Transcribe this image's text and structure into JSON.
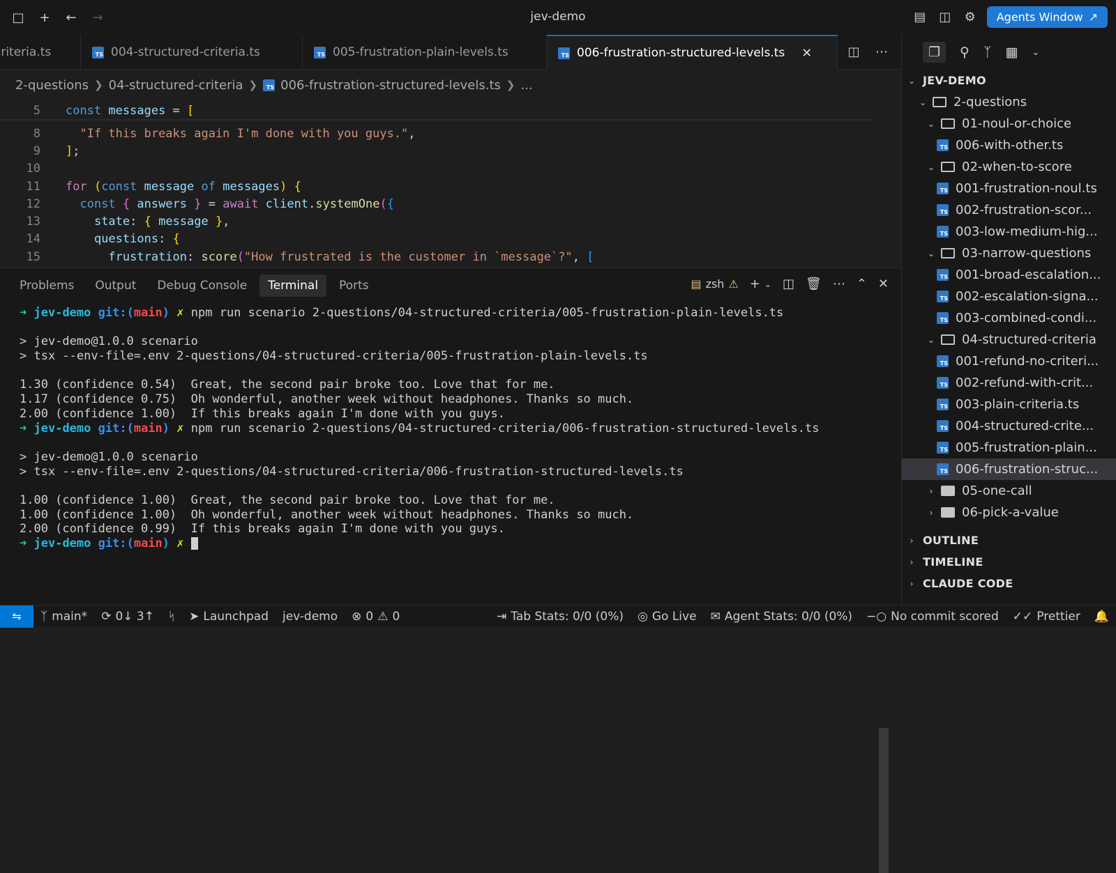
{
  "window": {
    "title": "jev-demo",
    "agents_button": "Agents Window"
  },
  "tabs": [
    {
      "label": "criteria.ts"
    },
    {
      "label": "004-structured-criteria.ts"
    },
    {
      "label": "005-frustration-plain-levels.ts"
    },
    {
      "label": "006-frustration-structured-levels.ts",
      "active": true
    }
  ],
  "breadcrumb": [
    "2-questions",
    "04-structured-criteria",
    "006-frustration-structured-levels.ts",
    "..."
  ],
  "editor": {
    "lines": [
      {
        "n": "5",
        "tokens": [
          [
            "kw",
            "const "
          ],
          [
            "var",
            "messages"
          ],
          [
            "pun",
            " = "
          ],
          [
            "br1",
            "["
          ]
        ]
      },
      {
        "n": "8",
        "tokens": [
          [
            "pun",
            "  "
          ],
          [
            "str",
            "\"If this breaks again I'm done with you guys.\""
          ],
          [
            "pun",
            ","
          ]
        ]
      },
      {
        "n": "9",
        "tokens": [
          [
            "br1",
            "]"
          ],
          [
            "pun",
            ";"
          ]
        ]
      },
      {
        "n": "10",
        "tokens": []
      },
      {
        "n": "11",
        "tokens": [
          [
            "ctl",
            "for "
          ],
          [
            "br1",
            "("
          ],
          [
            "kw",
            "const "
          ],
          [
            "var",
            "message "
          ],
          [
            "kw",
            "of "
          ],
          [
            "var",
            "messages"
          ],
          [
            "br1",
            ")"
          ],
          [
            "pun",
            " "
          ],
          [
            "br1",
            "{"
          ]
        ]
      },
      {
        "n": "12",
        "tokens": [
          [
            "pun",
            "  "
          ],
          [
            "kw",
            "const "
          ],
          [
            "br2",
            "{ "
          ],
          [
            "var",
            "answers "
          ],
          [
            "br2",
            "}"
          ],
          [
            "pun",
            " = "
          ],
          [
            "ctl",
            "await "
          ],
          [
            "var",
            "client"
          ],
          [
            "pun",
            "."
          ],
          [
            "fn",
            "systemOne"
          ],
          [
            "br2",
            "("
          ],
          [
            "br3",
            "{"
          ]
        ]
      },
      {
        "n": "13",
        "tokens": [
          [
            "pun",
            "    "
          ],
          [
            "var",
            "state"
          ],
          [
            "pun",
            ": "
          ],
          [
            "br1",
            "{ "
          ],
          [
            "var",
            "message "
          ],
          [
            "br1",
            "}"
          ],
          [
            "pun",
            ","
          ]
        ]
      },
      {
        "n": "14",
        "tokens": [
          [
            "pun",
            "    "
          ],
          [
            "var",
            "questions"
          ],
          [
            "pun",
            ": "
          ],
          [
            "br1",
            "{"
          ]
        ]
      },
      {
        "n": "15",
        "tokens": [
          [
            "pun",
            "      "
          ],
          [
            "var",
            "frustration"
          ],
          [
            "pun",
            ": "
          ],
          [
            "fn",
            "score"
          ],
          [
            "br2",
            "("
          ],
          [
            "str",
            "\"How frustrated is the customer in `message`?\""
          ],
          [
            "pun",
            ", "
          ],
          [
            "br3",
            "["
          ]
        ]
      }
    ]
  },
  "panel": {
    "tabs": [
      "Problems",
      "Output",
      "Debug Console",
      "Terminal",
      "Ports"
    ],
    "active_tab": "Terminal",
    "shell": "zsh"
  },
  "terminal": {
    "prompt": {
      "arrow": "➜",
      "repo": "jev-demo",
      "git": "git:(",
      "branch": "main",
      "git_close": ")",
      "dirty": "✗"
    },
    "lines": [
      {
        "type": "prompt",
        "cmd": "npm run scenario 2-questions/04-structured-criteria/005-frustration-plain-levels.ts"
      },
      {
        "type": "blank"
      },
      {
        "type": "text",
        "text": "> jev-demo@1.0.0 scenario"
      },
      {
        "type": "text",
        "text": "> tsx --env-file=.env 2-questions/04-structured-criteria/005-frustration-plain-levels.ts"
      },
      {
        "type": "blank"
      },
      {
        "type": "text",
        "text": "1.30 (confidence 0.54)  Great, the second pair broke too. Love that for me."
      },
      {
        "type": "text",
        "text": "1.17 (confidence 0.75)  Oh wonderful, another week without headphones. Thanks so much."
      },
      {
        "type": "text",
        "text": "2.00 (confidence 1.00)  If this breaks again I'm done with you guys."
      },
      {
        "type": "prompt",
        "cmd": "npm run scenario 2-questions/04-structured-criteria/006-frustration-structured-levels.ts"
      },
      {
        "type": "blank"
      },
      {
        "type": "text",
        "text": "> jev-demo@1.0.0 scenario"
      },
      {
        "type": "text",
        "text": "> tsx --env-file=.env 2-questions/04-structured-criteria/006-frustration-structured-levels.ts"
      },
      {
        "type": "blank"
      },
      {
        "type": "text",
        "text": "1.00 (confidence 1.00)  Great, the second pair broke too. Love that for me."
      },
      {
        "type": "text",
        "text": "1.00 (confidence 1.00)  Oh wonderful, another week without headphones. Thanks so much."
      },
      {
        "type": "text",
        "text": "2.00 (confidence 0.99)  If this breaks again I'm done with you guys."
      },
      {
        "type": "prompt_cursor",
        "cmd": ""
      }
    ]
  },
  "explorer": {
    "root": "JEV-DEMO",
    "rows": [
      {
        "kind": "folder",
        "open": true,
        "depth": 1,
        "label": "2-questions"
      },
      {
        "kind": "folder",
        "open": true,
        "depth": 2,
        "label": "01-noul-or-choice"
      },
      {
        "kind": "file",
        "depth": 3,
        "label": "006-with-other.ts"
      },
      {
        "kind": "folder",
        "open": true,
        "depth": 2,
        "label": "02-when-to-score"
      },
      {
        "kind": "file",
        "depth": 3,
        "label": "001-frustration-noul.ts"
      },
      {
        "kind": "file",
        "depth": 3,
        "label": "002-frustration-scor..."
      },
      {
        "kind": "file",
        "depth": 3,
        "label": "003-low-medium-hig..."
      },
      {
        "kind": "folder",
        "open": true,
        "depth": 2,
        "label": "03-narrow-questions"
      },
      {
        "kind": "file",
        "depth": 3,
        "label": "001-broad-escalation..."
      },
      {
        "kind": "file",
        "depth": 3,
        "label": "002-escalation-signa..."
      },
      {
        "kind": "file",
        "depth": 3,
        "label": "003-combined-condi..."
      },
      {
        "kind": "folder",
        "open": true,
        "depth": 2,
        "label": "04-structured-criteria"
      },
      {
        "kind": "file",
        "depth": 3,
        "label": "001-refund-no-criteri..."
      },
      {
        "kind": "file",
        "depth": 3,
        "label": "002-refund-with-crit..."
      },
      {
        "kind": "file",
        "depth": 3,
        "label": "003-plain-criteria.ts"
      },
      {
        "kind": "file",
        "depth": 3,
        "label": "004-structured-crite..."
      },
      {
        "kind": "file",
        "depth": 3,
        "label": "005-frustration-plain..."
      },
      {
        "kind": "file",
        "depth": 3,
        "label": "006-frustration-struc...",
        "selected": true
      },
      {
        "kind": "folder",
        "open": false,
        "depth": 2,
        "label": "05-one-call"
      },
      {
        "kind": "folder",
        "open": false,
        "depth": 2,
        "label": "06-pick-a-value"
      }
    ],
    "sections": [
      "OUTLINE",
      "TIMELINE",
      "CLAUDE CODE"
    ]
  },
  "statusbar": {
    "branch": "main*",
    "sync": "0↓ 3↑",
    "launchpad": "Launchpad",
    "workspace": "jev-demo",
    "errors": "0",
    "warnings": "0",
    "tab_stats": "Tab Stats: 0/0 (0%)",
    "go_live": "Go Live",
    "agent_stats": "Agent Stats: 0/0 (0%)",
    "commit": "No commit scored",
    "prettier": "Prettier"
  },
  "colors": {
    "accent": "#0078d4",
    "ts_icon": "#3178c6",
    "agents_button": "#1f7ad6"
  }
}
